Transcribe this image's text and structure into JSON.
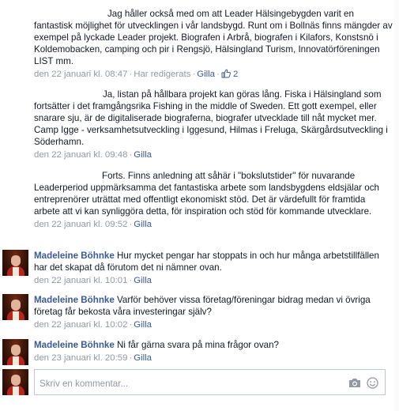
{
  "comments": [
    {
      "author": "",
      "text": "Jag håller också med om att Leader Hälsingebygden varit en fantastisk möjlighet för utvecklingen i vår landsbygd. Runt om i Bollnäs finns mängder av exempel på lyckade Leader projekt. Biografen i Arbrå, biografen i Kilafors, Konstsnö i Koldemobacken, camping och pir i Rengsjö, Hälsingland Turism, Innovatörföreningen LIST mm.",
      "time": "den 22 januari kl. 08:47",
      "edited": "Har redigerats",
      "like": "Gilla",
      "like_count": "2"
    },
    {
      "author": "",
      "text": "Ja, listan på hållbara projekt kan göras lång. Fiska i Hälsingland som fortsätter i det framgångsrika Fishing in the middle of Sweden. Ett gott exempel, eller snarare sju, är de digitaliserade biograferna, biografer utvecklade till nåt mycket mer. Camp Igge - verksamhetsutveckling i Iggesund, Hilmas i Freluga, Skärgårdsutveckling i Söderhamn.",
      "time": "den 22 januari kl. 09:48",
      "like": "Gilla"
    },
    {
      "author": "",
      "text": "Forts. Finns anledning att såhär i \"bokslutstider\" för nuvarande Leaderperiod uppmärksamma det fantastiska arbete som landsbygdens eldsjälar och entreprenörer uträttat med offentligt ekonomiskt stöd. Det är värdefullt för framtida arbete att vi kan synliggöra detta, för inspiration och stöd för kommande utvecklare.",
      "time": "den 22 januari kl. 09:52",
      "like": "Gilla"
    },
    {
      "author": "Madeleine Böhnke",
      "text": "Hur mycket pengar har stoppats in och hur många arbetstillfällen har det skapat då förutom det ni nämner ovan.",
      "time": "den 22 januari kl. 10:01",
      "like": "Gilla"
    },
    {
      "author": "Madeleine Böhnke",
      "text": "Varför behöver vissa företag/föreningar bidrag medan vi övriga företag får bekosta våra investeringar själv?",
      "time": "den 22 januari kl. 10:02",
      "like": "Gilla"
    },
    {
      "author": "Madeleine Böhnke",
      "text": "Ni får gärna svara på mina frågor ovan?",
      "time": "den 23 januari kl. 20:59",
      "like": "Gilla"
    }
  ],
  "composer": {
    "placeholder": "Skriv en kommentar..."
  },
  "icons": {
    "like": "thumbs-up-icon",
    "camera": "camera-icon",
    "emoticon": "smiley-icon"
  },
  "colors": {
    "link": "#3b5998",
    "meta": "#9197a3",
    "text": "#141823"
  }
}
